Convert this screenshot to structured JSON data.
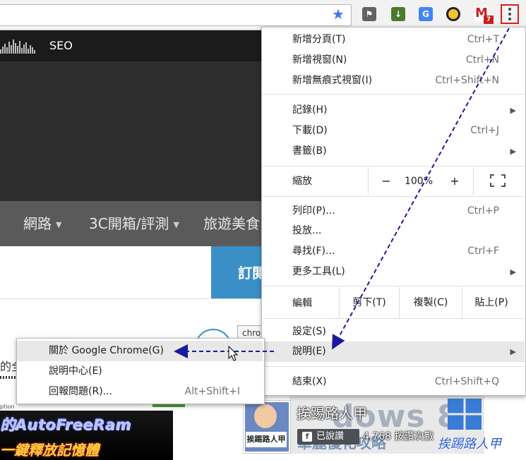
{
  "colors": {
    "menu_bg": "#ffffff",
    "menu_highlight": "#e8e8e8",
    "accent_blue": "#3a8fc7",
    "annotation_arrow": "#1a1aa0",
    "menu_button_border": "#d61f1f"
  },
  "toolbar": {
    "bookmark_icon": "star-icon",
    "extensions": [
      {
        "name": "evernote-icon",
        "glyph": "⚑"
      },
      {
        "name": "download-icon",
        "glyph": "↓"
      },
      {
        "name": "translate-icon",
        "glyph": "G"
      },
      {
        "name": "search-extension-icon",
        "glyph": ""
      },
      {
        "name": "gmail-icon",
        "glyph": "M",
        "badge": "7"
      }
    ],
    "menu_icon": "more-vert-icon"
  },
  "page": {
    "seo_label": "SEO",
    "nav": [
      {
        "label": "網路"
      },
      {
        "label": "3C開箱/評測"
      },
      {
        "label": "旅遊美食"
      }
    ],
    "subscribe_label": "訂閱",
    "article_snippet": "的全",
    "article_subtext": "ption",
    "chrome_thumb_text": "chro",
    "banner_line1": "的AutoFreeRam",
    "banner_line2": "一鍵釋放記憶體",
    "facebook": {
      "page_name": "挨踢路人甲",
      "like_label": "已說讚",
      "like_count": "4,768 按讚次數",
      "avatar_label": "挨踢路人甲",
      "cover_word": "dows 8",
      "cover_tag": "華麗優化攻略"
    },
    "watermark": "挨踢路人甲"
  },
  "chrome_menu": {
    "group1": [
      {
        "label": "新增分頁(T)",
        "shortcut": "Ctrl+T"
      },
      {
        "label": "新增視窗(N)",
        "shortcut": "Ctrl+N"
      },
      {
        "label": "新增無痕式視窗(I)",
        "shortcut": "Ctrl+Shift+N"
      }
    ],
    "group2": [
      {
        "label": "記錄(H)",
        "shortcut": "",
        "submenu": true
      },
      {
        "label": "下載(D)",
        "shortcut": "Ctrl+J"
      },
      {
        "label": "書籤(B)",
        "shortcut": "",
        "submenu": true
      }
    ],
    "zoom": {
      "label": "縮放",
      "minus": "−",
      "value": "100%",
      "plus": "+"
    },
    "group3": [
      {
        "label": "列印(P)...",
        "shortcut": "Ctrl+P"
      },
      {
        "label": "投放...",
        "shortcut": ""
      },
      {
        "label": "尋找(F)...",
        "shortcut": "Ctrl+F"
      },
      {
        "label": "更多工具(L)",
        "shortcut": "",
        "submenu": true
      }
    ],
    "edit": {
      "label": "編輯",
      "cut": "剪下(T)",
      "copy": "複製(C)",
      "paste": "貼上(P)"
    },
    "settings": {
      "label": "設定(S)"
    },
    "help": {
      "label": "說明(E)"
    },
    "exit": {
      "label": "結束(X)",
      "shortcut": "Ctrl+Shift+Q"
    }
  },
  "help_submenu": [
    {
      "label": "關於 Google Chrome(G)",
      "shortcut": ""
    },
    {
      "label": "說明中心(E)",
      "shortcut": ""
    },
    {
      "label": "回報問題(R)...",
      "shortcut": "Alt+Shift+I"
    }
  ]
}
